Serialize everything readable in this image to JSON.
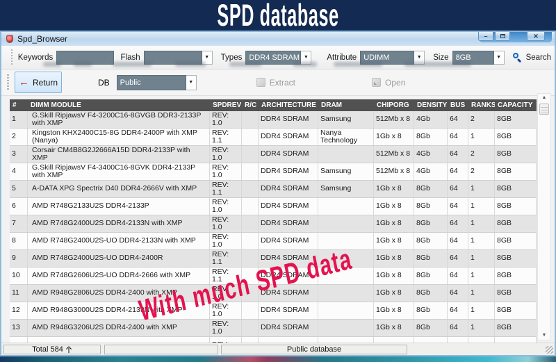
{
  "banner": {
    "title": "SPD database"
  },
  "window": {
    "title": "Spd_Browser",
    "controls": {
      "minimize_glyph": "–",
      "close_glyph": "✕"
    }
  },
  "icons": {
    "dropdown_glyph": "▼",
    "scroll_up_glyph": "▲",
    "scroll_down_glyph": "▼"
  },
  "toolbar": {
    "keywords_label": "Keywords",
    "keywords_value": "",
    "flash_label": "Flash",
    "flash_value": "",
    "types_label": "Types",
    "types_value": "DDR4 SDRAM",
    "attribute_label": "Attribute",
    "attribute_value": "UDIMM",
    "size_label": "Size",
    "size_value": "8GB",
    "search_label": "Search"
  },
  "actionbar": {
    "return_label": "Return",
    "return_arrow_glyph": "←",
    "db_label": "DB",
    "db_value": "Public",
    "extract_label": "Extract",
    "open_label": "Open"
  },
  "table": {
    "columns": [
      "#",
      "DIMM MODULE",
      "SPDREV",
      "R/C",
      "ARCHITECTURE",
      "DRAM",
      "CHIPORG",
      "DENSITY",
      "BUS",
      "RANKS",
      "CAPACITY"
    ],
    "rows": [
      {
        "num": "1",
        "module": "G.Skill RipjawsV F4-3200C16-8GVGB DDR3-2133P with XMP",
        "rev": "REV: 1.0",
        "rc": "",
        "arch": "DDR4 SDRAM",
        "dram": "Samsung",
        "chiporg": "512Mb x 8",
        "density": "4Gb",
        "bus": "64",
        "ranks": "2",
        "capacity": "8GB"
      },
      {
        "num": "2",
        "module": "Kingston KHX2400C15-8G DDR4-2400P with XMP (Nanya)",
        "rev": "REV: 1.1",
        "rc": "",
        "arch": "DDR4 SDRAM",
        "dram": "Nanya Technology",
        "chiporg": "1Gb x 8",
        "density": "8Gb",
        "bus": "64",
        "ranks": "1",
        "capacity": "8GB"
      },
      {
        "num": "3",
        "module": "Corsair CM4B8G2J2666A15D DDR4-2133P with XMP",
        "rev": "REV: 1.0",
        "rc": "",
        "arch": "DDR4 SDRAM",
        "dram": "",
        "chiporg": "512Mb x 8",
        "density": "4Gb",
        "bus": "64",
        "ranks": "2",
        "capacity": "8GB"
      },
      {
        "num": "4",
        "module": "G.Skill RipjawsV F4-3400C16-8GVK DDR4-2133P with XMP",
        "rev": "REV: 1.0",
        "rc": "",
        "arch": "DDR4 SDRAM",
        "dram": "Samsung",
        "chiporg": "512Mb x 8",
        "density": "4Gb",
        "bus": "64",
        "ranks": "2",
        "capacity": "8GB"
      },
      {
        "num": "5",
        "module": "A-DATA XPG Spectrix D40 DDR4-2666V with XMP",
        "rev": "REV: 1.1",
        "rc": "",
        "arch": "DDR4 SDRAM",
        "dram": "Samsung",
        "chiporg": "1Gb x 8",
        "density": "8Gb",
        "bus": "64",
        "ranks": "1",
        "capacity": "8GB"
      },
      {
        "num": "6",
        "module": "AMD R748G2133U2S DDR4-2133P",
        "rev": "REV: 1.0",
        "rc": "",
        "arch": "DDR4 SDRAM",
        "dram": "",
        "chiporg": "1Gb x 8",
        "density": "8Gb",
        "bus": "64",
        "ranks": "1",
        "capacity": "8GB"
      },
      {
        "num": "7",
        "module": "AMD R748G2400U2S DDR4-2133N with XMP",
        "rev": "REV: 1.0",
        "rc": "",
        "arch": "DDR4 SDRAM",
        "dram": "",
        "chiporg": "1Gb x 8",
        "density": "8Gb",
        "bus": "64",
        "ranks": "1",
        "capacity": "8GB"
      },
      {
        "num": "8",
        "module": "AMD R748G2400U2S-UO DDR4-2133N with XMP",
        "rev": "REV: 1.0",
        "rc": "",
        "arch": "DDR4 SDRAM",
        "dram": "",
        "chiporg": "1Gb x 8",
        "density": "8Gb",
        "bus": "64",
        "ranks": "1",
        "capacity": "8GB"
      },
      {
        "num": "9",
        "module": "AMD R748G2400U2S-UO DDR4-2400R",
        "rev": "REV: 1.1",
        "rc": "",
        "arch": "DDR4 SDRAM",
        "dram": "",
        "chiporg": "1Gb x 8",
        "density": "8Gb",
        "bus": "64",
        "ranks": "1",
        "capacity": "8GB"
      },
      {
        "num": "10",
        "module": "AMD R748G2606U2S-UO DDR4-2666 with XMP",
        "rev": "REV: 1.1",
        "rc": "",
        "arch": "DDR4 SDRAM",
        "dram": "",
        "chiporg": "1Gb x 8",
        "density": "8Gb",
        "bus": "64",
        "ranks": "1",
        "capacity": "8GB"
      },
      {
        "num": "11",
        "module": "AMD R948G2806U2S DDR4-2400 with XMP",
        "rev": "REV: 1.0",
        "rc": "",
        "arch": "DDR4 SDRAM",
        "dram": "",
        "chiporg": "1Gb x 8",
        "density": "8Gb",
        "bus": "64",
        "ranks": "1",
        "capacity": "8GB"
      },
      {
        "num": "12",
        "module": "AMD R948G3000U2S DDR4-2133N with XMP",
        "rev": "REV: 1.0",
        "rc": "",
        "arch": "DDR4 SDRAM",
        "dram": "",
        "chiporg": "1Gb x 8",
        "density": "8Gb",
        "bus": "64",
        "ranks": "1",
        "capacity": "8GB"
      },
      {
        "num": "13",
        "module": "AMD R948G3206U2S DDR4-2400 with XMP",
        "rev": "REV: 1.0",
        "rc": "",
        "arch": "DDR4 SDRAM",
        "dram": "",
        "chiporg": "1Gb x 8",
        "density": "8Gb",
        "bus": "64",
        "ranks": "1",
        "capacity": "8GB"
      }
    ],
    "partial_row": {
      "num": "",
      "module": "",
      "rev": "REV:",
      "rc": "",
      "arch": "",
      "dram": "",
      "chiporg": "",
      "density": "",
      "bus": "",
      "ranks": "",
      "capacity": ""
    }
  },
  "watermark": {
    "text": "With much SPD data",
    "color": "#e4134f"
  },
  "statusbar": {
    "total_label": "Total 584",
    "total_unit": "个",
    "middle": "",
    "db_name": "Public database"
  }
}
